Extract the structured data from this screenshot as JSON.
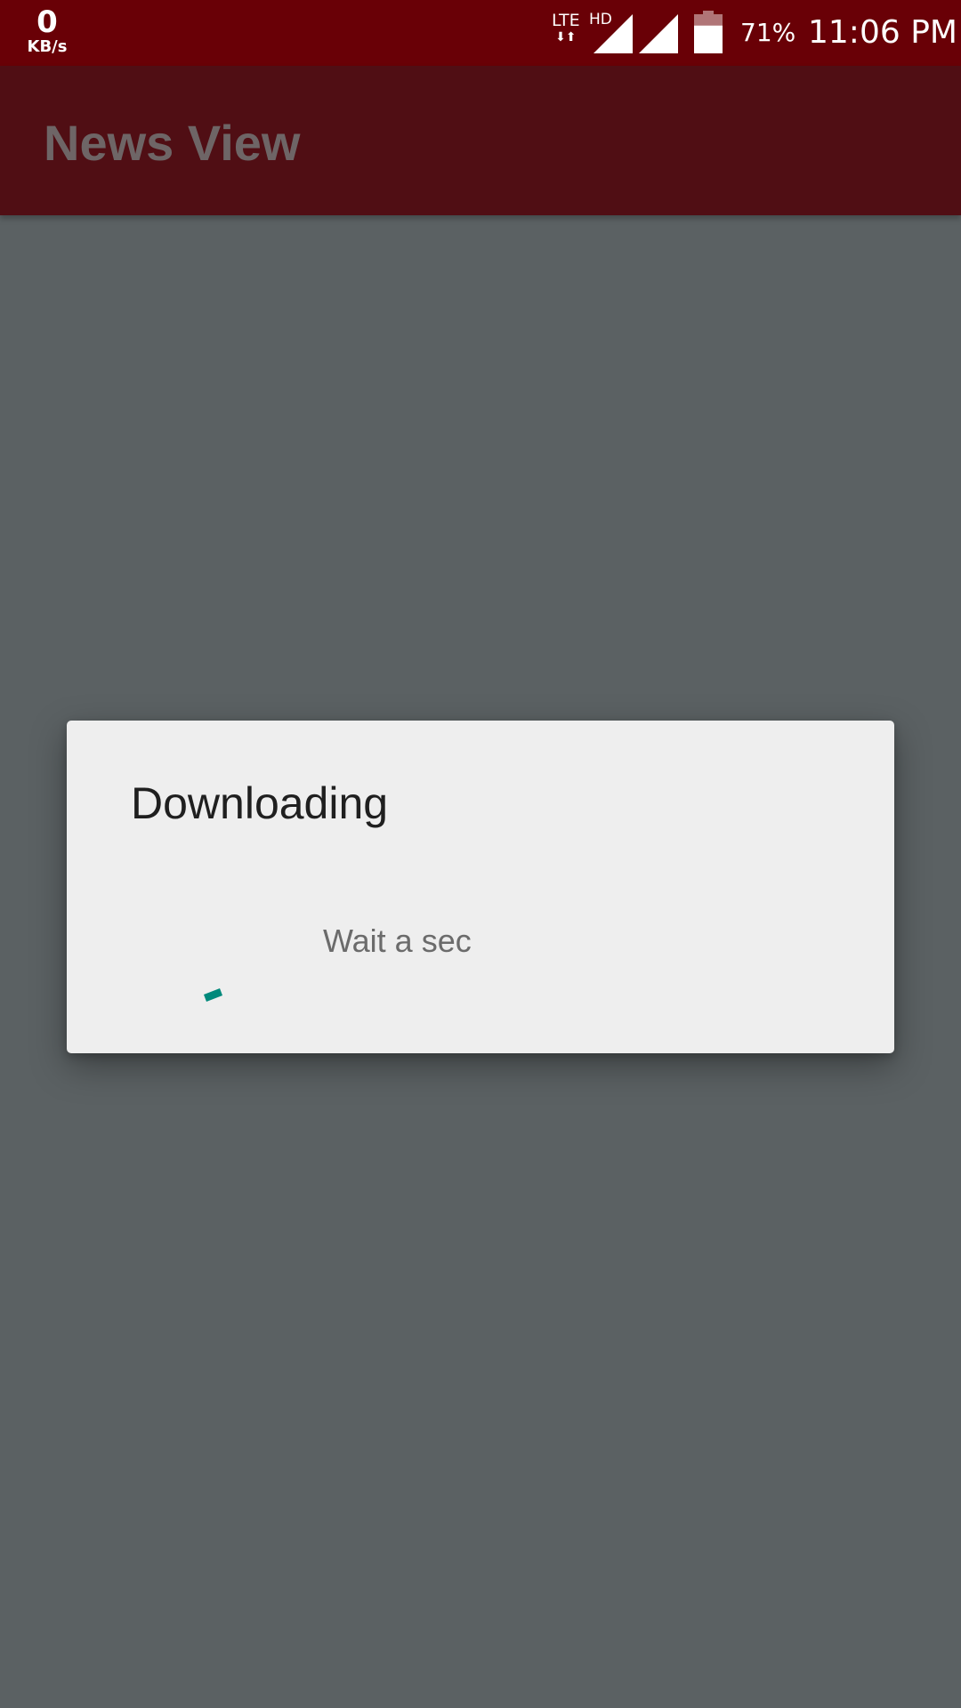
{
  "status_bar": {
    "net_speed_value": "0",
    "net_speed_unit": "KB/s",
    "network_type": "LTE",
    "network_arrows": "⬇⬆",
    "hd_label": "HD",
    "battery_percent": "71%",
    "battery_level": 0.71,
    "time": "11:06 PM",
    "background_color": "#690006"
  },
  "app_bar": {
    "title": "News View",
    "background_color": "#500e14"
  },
  "dialog": {
    "title": "Downloading",
    "message": "Wait a sec",
    "spinner_color": "#00897b"
  },
  "scrim_color": "#5b6163"
}
